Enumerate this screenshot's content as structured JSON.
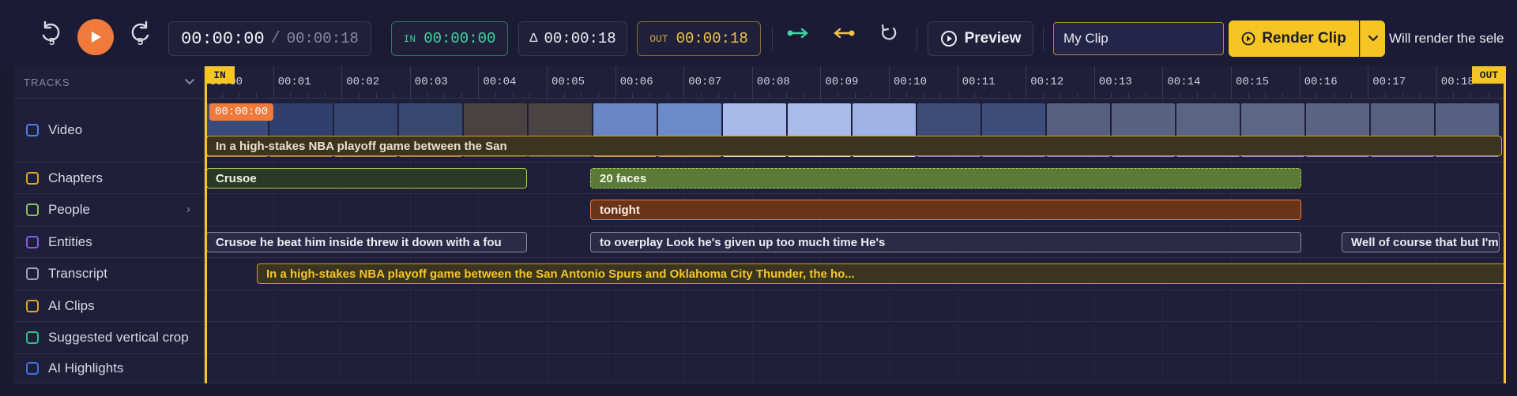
{
  "toolbar": {
    "rewind_badge": "5",
    "forward_badge": "5",
    "timecode_current": "00:00:00",
    "timecode_sep": "/",
    "timecode_total": "00:00:18",
    "in_label": "IN",
    "in_value": "00:00:00",
    "delta_label": "Δ",
    "delta_value": "00:00:18",
    "out_label": "OUT",
    "out_value": "00:00:18",
    "preview_label": "Preview",
    "clip_name_value": "My Clip",
    "render_label": "Render Clip",
    "render_note": "Will render the sele"
  },
  "timeline": {
    "tracks_header": "TRACKS",
    "ruler_ticks": [
      "00:00",
      "00:01",
      "00:02",
      "00:03",
      "00:04",
      "00:05",
      "00:06",
      "00:07",
      "00:08",
      "00:09",
      "00:10",
      "00:11",
      "00:12",
      "00:13",
      "00:14",
      "00:15",
      "00:16",
      "00:17",
      "00:18"
    ],
    "in_flag": "IN",
    "out_flag": "OUT",
    "playhead_time": "00:00:00",
    "tracks": [
      {
        "label": "Video",
        "color": "#4f7de6"
      },
      {
        "label": "Chapters",
        "color": "#d9a72a"
      },
      {
        "label": "People",
        "color": "#8fc25a",
        "expandable": true
      },
      {
        "label": "Entities",
        "color": "#8a5be6"
      },
      {
        "label": "Transcript",
        "color": "#a0a0b8"
      },
      {
        "label": "AI Clips",
        "color": "#d9a72a"
      },
      {
        "label": "Suggested vertical crop",
        "color": "#2fbf8a"
      },
      {
        "label": "AI Highlights",
        "color": "#3f6fe0"
      }
    ],
    "chapters_clip": "In a high-stakes NBA playoff game between the San",
    "people_clip_1": "Crusoe",
    "people_clip_2": "20 faces",
    "entities_clip": "tonight",
    "transcript_clip_1": "Crusoe he beat him inside threw it down with a fou",
    "transcript_clip_2": "to overplay Look he's given up too much time He's",
    "transcript_clip_3": "Well of course that but I'm",
    "ai_clip": "In a high-stakes NBA playoff game between the San Antonio Spurs and Oklahoma City Thunder, the ho..."
  }
}
